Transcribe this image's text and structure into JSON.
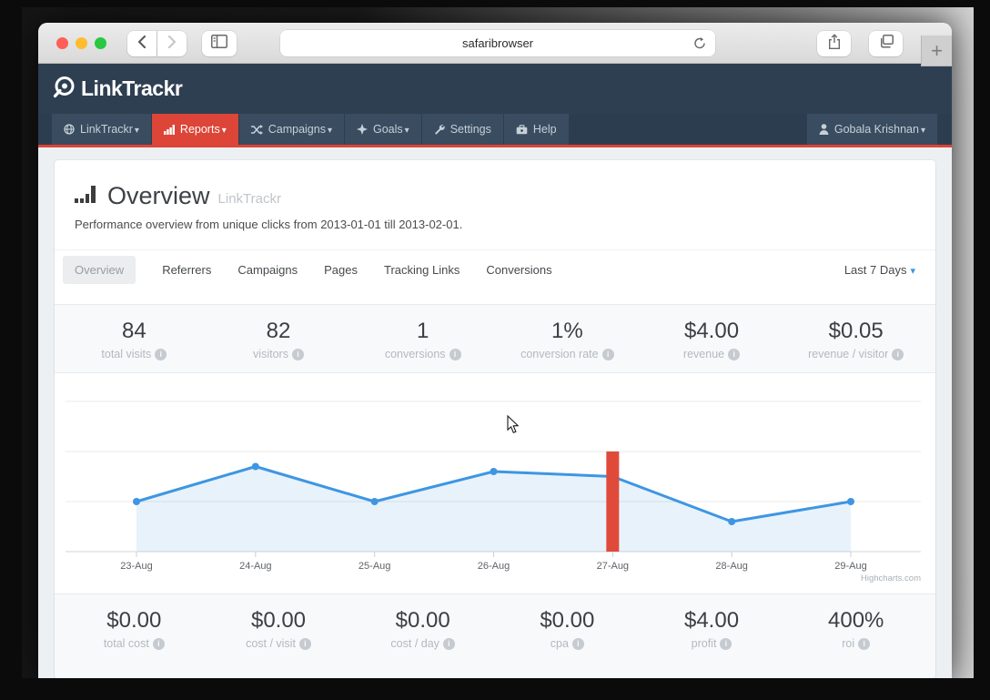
{
  "browser": {
    "url_text": "safaribrowser",
    "new_tab_label": "+",
    "traffic_lights": {
      "close": "#ff5f57",
      "minimize": "#febc2e",
      "zoom": "#28c840"
    }
  },
  "app": {
    "brand": "LinkTrackr",
    "nav": [
      {
        "label": "LinkTrackr",
        "icon": "globe-icon",
        "caret": true,
        "active": false
      },
      {
        "label": "Reports",
        "icon": "bar-chart-icon",
        "caret": true,
        "active": true
      },
      {
        "label": "Campaigns",
        "icon": "shuffle-icon",
        "caret": true,
        "active": false
      },
      {
        "label": "Goals",
        "icon": "goals-icon",
        "caret": true,
        "active": false
      },
      {
        "label": "Settings",
        "icon": "wrench-icon",
        "caret": false,
        "active": false
      },
      {
        "label": "Help",
        "icon": "briefcase-icon",
        "caret": false,
        "active": false
      }
    ],
    "user_menu": {
      "label": "Gobala Krishnan",
      "icon": "user-icon"
    }
  },
  "page": {
    "title": "Overview",
    "title_suffix": "LinkTrackr",
    "subtitle": "Performance overview from unique clicks from 2013-01-01 till 2013-02-01.",
    "tabs": [
      "Overview",
      "Referrers",
      "Campaigns",
      "Pages",
      "Tracking Links",
      "Conversions"
    ],
    "active_tab": "Overview",
    "date_range": "Last 7 Days",
    "stats_top": [
      {
        "value": "84",
        "label": "total visits"
      },
      {
        "value": "82",
        "label": "visitors"
      },
      {
        "value": "1",
        "label": "conversions"
      },
      {
        "value": "1%",
        "label": "conversion rate"
      },
      {
        "value": "$4.00",
        "label": "revenue"
      },
      {
        "value": "$0.05",
        "label": "revenue / visitor"
      }
    ],
    "stats_bottom": [
      {
        "value": "$0.00",
        "label": "total cost"
      },
      {
        "value": "$0.00",
        "label": "cost / visit"
      },
      {
        "value": "$0.00",
        "label": "cost / day"
      },
      {
        "value": "$0.00",
        "label": "cpa"
      },
      {
        "value": "$4.00",
        "label": "profit"
      },
      {
        "value": "400%",
        "label": "roi"
      }
    ],
    "credits": "Highcharts.com"
  },
  "chart_data": {
    "type": "line",
    "categories": [
      "23-Aug",
      "24-Aug",
      "25-Aug",
      "26-Aug",
      "27-Aug",
      "28-Aug",
      "29-Aug"
    ],
    "series": [
      {
        "name": "visits",
        "render": "area-line",
        "color": "#3e96e2",
        "fill_opacity": 0.12,
        "values": [
          10,
          17,
          10,
          16,
          15,
          6,
          10
        ]
      },
      {
        "name": "conversions",
        "render": "bar",
        "color": "#e04a3a",
        "category": "27-Aug",
        "value": 1,
        "bar_top_in_left_axis_units": 20
      }
    ],
    "title": "",
    "xlabel": "",
    "ylabel": "",
    "ylim": [
      0,
      32
    ],
    "gridlines": [
      0,
      10,
      20,
      30
    ],
    "yaxis_labels": "hidden",
    "legend": "off"
  },
  "colors": {
    "brand_navy": "#2e3f51",
    "accent_red": "#dc4537",
    "chart_blue": "#3e96e2",
    "chart_bar_red": "#e04a3a",
    "grid": "#e8e8e8",
    "axis": "#d6d6d6"
  }
}
